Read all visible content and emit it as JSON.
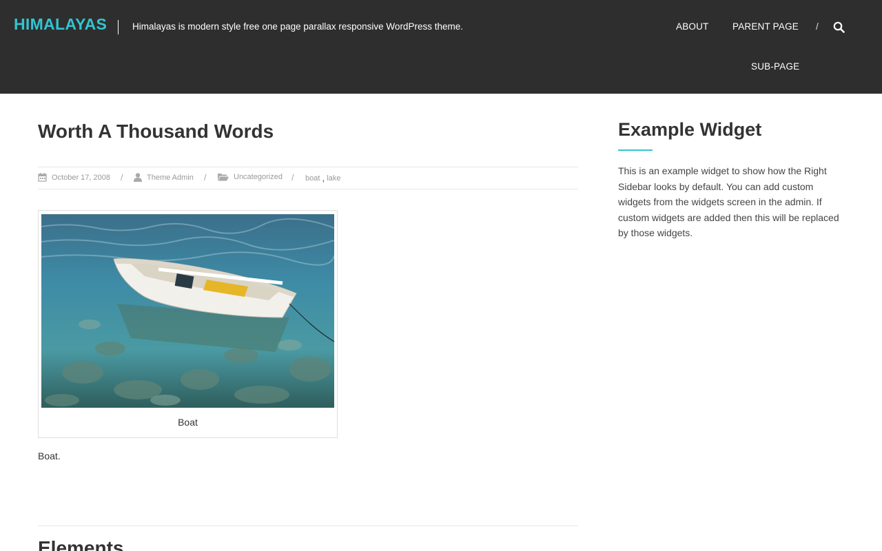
{
  "header": {
    "site_title": "HIMALAYAS",
    "tagline": "Himalayas is modern style free one page parallax responsive WordPress theme.",
    "nav": {
      "about": "ABOUT",
      "parent_page": "PARENT PAGE",
      "separator": "/",
      "sub_page": "SUB-PAGE"
    },
    "search_icon": "search-icon"
  },
  "post": {
    "title": "Worth A Thousand Words",
    "meta": {
      "date": "October 17, 2008",
      "author": "Theme Admin",
      "category": "Uncategorized",
      "tags": [
        "boat",
        "lake"
      ],
      "tag_separator": ",",
      "slash": "/"
    },
    "image_caption": "Boat",
    "body": "Boat."
  },
  "next_post": {
    "title": "Elements"
  },
  "sidebar": {
    "widget_title": "Example Widget",
    "widget_text": "This is an example widget to show how the Right Sidebar looks by default. You can add custom widgets from the widgets screen in the admin. If custom widgets are added then this will be replaced by those widgets."
  },
  "colors": {
    "accent": "#32c4d1",
    "header_bg": "#2e2e2e"
  }
}
